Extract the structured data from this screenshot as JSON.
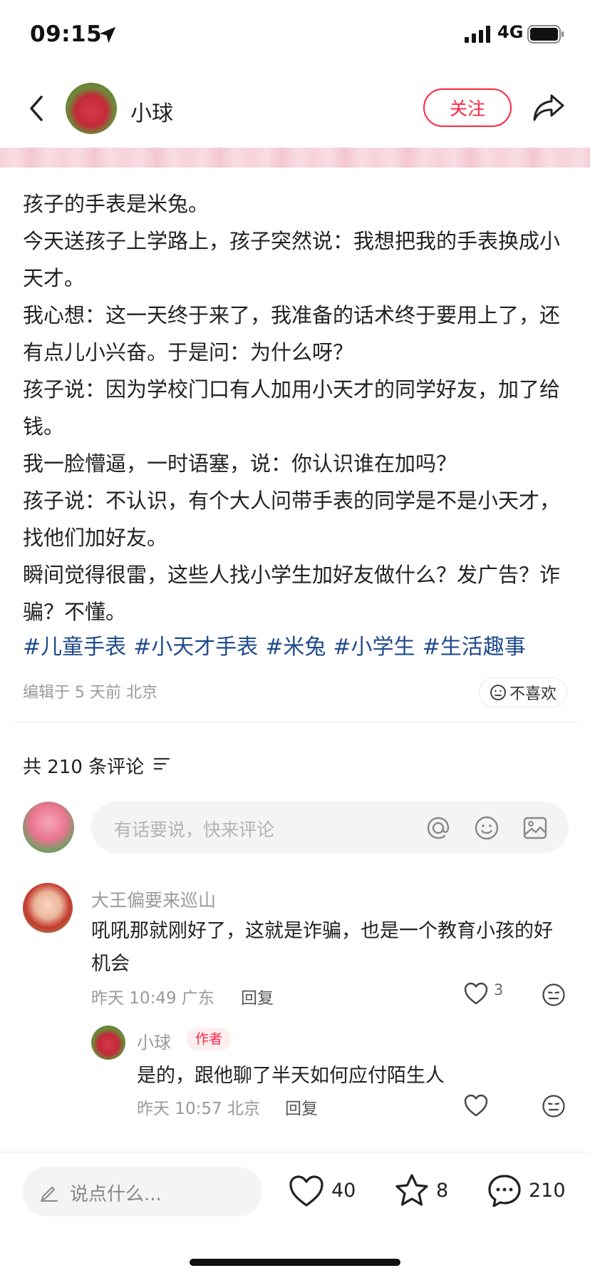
{
  "status_bar": {
    "time": "09:15",
    "network": "4G"
  },
  "header": {
    "author_name": "小球",
    "follow_label": "关注"
  },
  "post": {
    "paragraphs": [
      "孩子的手表是米兔。",
      "今天送孩子上学路上，孩子突然说：我想把我的手表换成小天才。",
      "我心想：这一天终于来了，我准备的话术终于要用上了，还有点儿小兴奋。于是问：为什么呀？",
      "孩子说：因为学校门口有人加用小天才的同学好友，加了给钱。",
      "我一脸懵逼，一时语塞，说：你认识谁在加吗？",
      "孩子说：不认识，有个大人问带手表的同学是不是小天才，找他们加好友。",
      "瞬间觉得很雷，这些人找小学生加好友做什么？发广告？诈骗？不懂。"
    ],
    "tags": [
      "#儿童手表",
      "#小天才手表",
      "#米兔",
      "#小学生",
      "#生活趣事"
    ],
    "meta": "编辑于 5 天前 北京",
    "dislike_label": "不喜欢"
  },
  "comments_section": {
    "count_label": "共 210 条评论",
    "input_placeholder": "有话要说，快来评论",
    "comments": [
      {
        "name": "大王偏要来巡山",
        "text": "吼吼那就刚好了，这就是诈骗，也是一个教育小孩的好机会",
        "time": "昨天 10:49 广东",
        "reply_label": "回复",
        "likes": "3",
        "replies": [
          {
            "name": "小球",
            "badge": "作者",
            "text": "是的，跟他聊了半天如何应付陌生人",
            "time": "昨天 10:57 北京",
            "reply_label": "回复"
          }
        ]
      }
    ]
  },
  "bottom_bar": {
    "placeholder": "说点什么...",
    "likes": "40",
    "stars": "8",
    "comments": "210"
  },
  "colors": {
    "accent": "#ff2442",
    "tag": "#1f4a8c"
  }
}
